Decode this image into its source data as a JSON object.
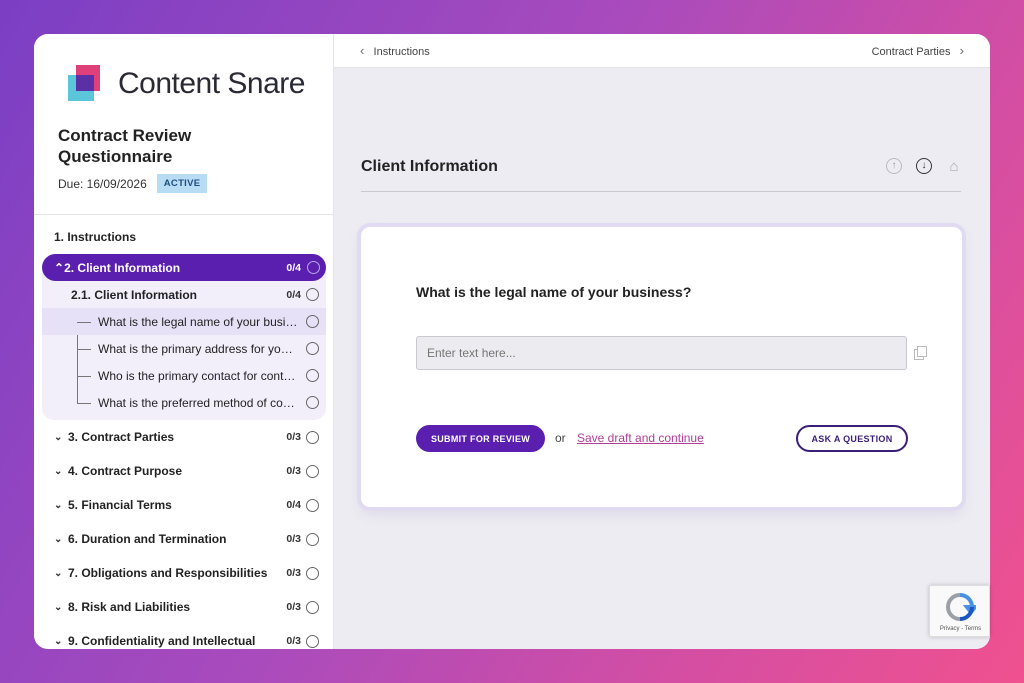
{
  "brand": {
    "name": "Content Snare"
  },
  "questionnaire": {
    "title": "Contract Review Questionnaire",
    "due": "Due: 16/09/2026",
    "status": "ACTIVE"
  },
  "nav": {
    "instructions": "1. Instructions",
    "active_section": {
      "label": "2. Client Information",
      "count": "0/4"
    },
    "sub_section": {
      "label": "2.1. Client Information",
      "count": "0/4"
    },
    "questions": [
      "What is the legal name of your business?",
      "What is the primary address for your business?",
      "Who is the primary contact for contracts?",
      "What is the preferred method of communication?"
    ],
    "sections": [
      {
        "label": "3. Contract Parties",
        "count": "0/3"
      },
      {
        "label": "4. Contract Purpose",
        "count": "0/3"
      },
      {
        "label": "5. Financial Terms",
        "count": "0/4"
      },
      {
        "label": "6. Duration and Termination",
        "count": "0/3"
      },
      {
        "label": "7. Obligations and Responsibilities",
        "count": "0/3"
      },
      {
        "label": "8. Risk and Liabilities",
        "count": "0/3"
      },
      {
        "label": "9. Confidentiality and Intellectual",
        "count": "0/3"
      }
    ]
  },
  "topbar": {
    "prev": "Instructions",
    "next": "Contract Parties"
  },
  "main": {
    "section_title": "Client Information",
    "question": "What is the legal name of your business?",
    "input_placeholder": "Enter text here...",
    "submit_label": "SUBMIT FOR REVIEW",
    "or_text": "or",
    "save_link": "Save draft and continue",
    "ask_label": "ASK A QUESTION"
  },
  "recaptcha": {
    "text": "Privacy - Terms"
  },
  "colors": {
    "accent": "#5b1fb0",
    "link": "#b03f96",
    "badge_bg": "#b9dcf5"
  }
}
